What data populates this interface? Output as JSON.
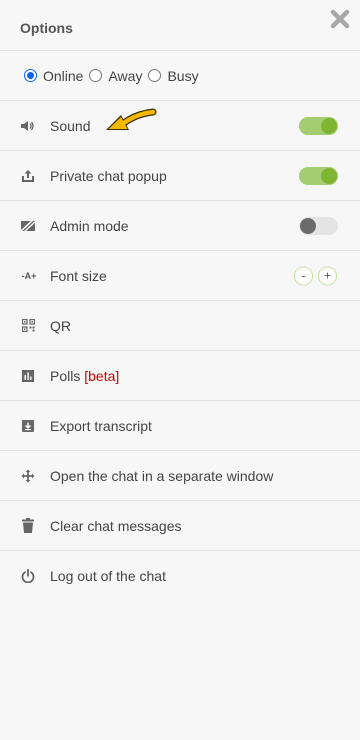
{
  "header": {
    "title": "Options"
  },
  "status": {
    "options": [
      {
        "label": "Online",
        "checked": true
      },
      {
        "label": "Away",
        "checked": false
      },
      {
        "label": "Busy",
        "checked": false
      }
    ]
  },
  "menu": {
    "sound": {
      "label": "Sound",
      "enabled": true
    },
    "private_popup": {
      "label": "Private chat popup",
      "enabled": true
    },
    "admin_mode": {
      "label": "Admin mode",
      "enabled": false
    },
    "font_size": {
      "label": "Font size",
      "icon_text": "-A+",
      "decrease": "-",
      "increase": "+"
    },
    "qr": {
      "label": "QR"
    },
    "polls": {
      "label": "Polls",
      "badge": "[beta]"
    },
    "export": {
      "label": "Export transcript"
    },
    "open_window": {
      "label": "Open the chat in a separate window"
    },
    "clear": {
      "label": "Clear chat messages"
    },
    "logout": {
      "label": "Log out of the chat"
    }
  },
  "colors": {
    "toggle_on_track": "#a4cc70",
    "toggle_on_knob": "#7fb532",
    "toggle_off_track": "#e4e4e4",
    "toggle_off_knob": "#6b6b6b",
    "beta": "#d40000",
    "annotation_arrow": "#f5b800"
  }
}
